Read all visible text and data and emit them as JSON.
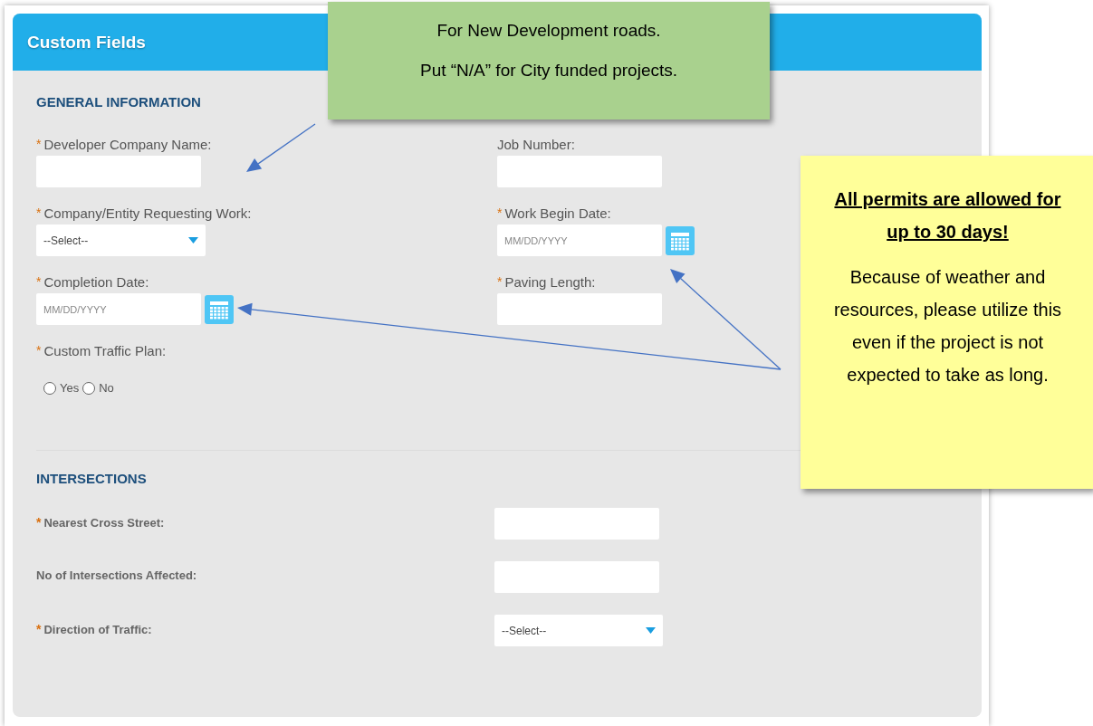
{
  "panel": {
    "title": "Custom Fields",
    "sections": [
      {
        "heading": "GENERAL INFORMATION",
        "kind": "grid",
        "fields": [
          {
            "required_mark": "*",
            "label": "Developer Company Name:",
            "kind": "text"
          },
          {
            "label": "Job Number:",
            "kind": "text"
          },
          {
            "required_mark": "*",
            "label": "Company/Entity Requesting Work:",
            "kind": "select",
            "value": "--Select--"
          },
          {
            "required_mark": "*",
            "label": "Work Begin Date:",
            "kind": "date",
            "placeholder": "MM/DD/YYYY"
          },
          {
            "required_mark": "*",
            "label": "Completion Date:",
            "kind": "date",
            "placeholder": "MM/DD/YYYY"
          },
          {
            "required_mark": "*",
            "label": "Paving Length:",
            "kind": "text"
          },
          {
            "required_mark": "*",
            "label": "Custom Traffic Plan:",
            "kind": "radio",
            "options": [
              {
                "label": "Yes",
                "selected": false
              },
              {
                "label": "No",
                "selected": false
              }
            ]
          }
        ]
      },
      {
        "heading": "INTERSECTIONS",
        "kind": "inline",
        "fields": [
          {
            "required_mark": "*",
            "label": "Nearest Cross Street:",
            "kind": "text"
          },
          {
            "label": "No of Intersections Affected:",
            "kind": "text"
          },
          {
            "required_mark": "*",
            "label": "Direction of Traffic:",
            "kind": "select",
            "value": "--Select--"
          }
        ]
      }
    ]
  },
  "callouts": [
    {
      "kind": "note",
      "color": "#a9d18e",
      "lines": [
        "For New Development roads.",
        "Put “N/A” for City funded projects."
      ]
    },
    {
      "kind": "warning",
      "color": "#ffff99",
      "heading": "All permits are allowed for up to 30 days!",
      "lines": [
        "Because of weather and resources, please utilize this even if the project is not expected to take as long."
      ]
    }
  ]
}
